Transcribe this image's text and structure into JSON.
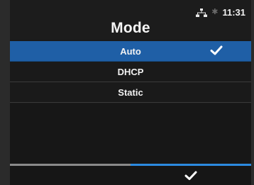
{
  "status": {
    "time": "11:31",
    "network_icon": "network-icon",
    "bluetooth_icon": "bluetooth-icon"
  },
  "title": "Mode",
  "options": [
    {
      "label": "Auto",
      "selected": true
    },
    {
      "label": "DHCP",
      "selected": false
    },
    {
      "label": "Static",
      "selected": false
    }
  ],
  "softkeys": {
    "left": {
      "label": "",
      "icon": "none"
    },
    "right": {
      "icon": "checkmark-icon"
    }
  },
  "colors": {
    "selection": "#1f5fa6",
    "confirm_bar": "#2c8ae0",
    "back_bar": "#8a8a8a"
  }
}
